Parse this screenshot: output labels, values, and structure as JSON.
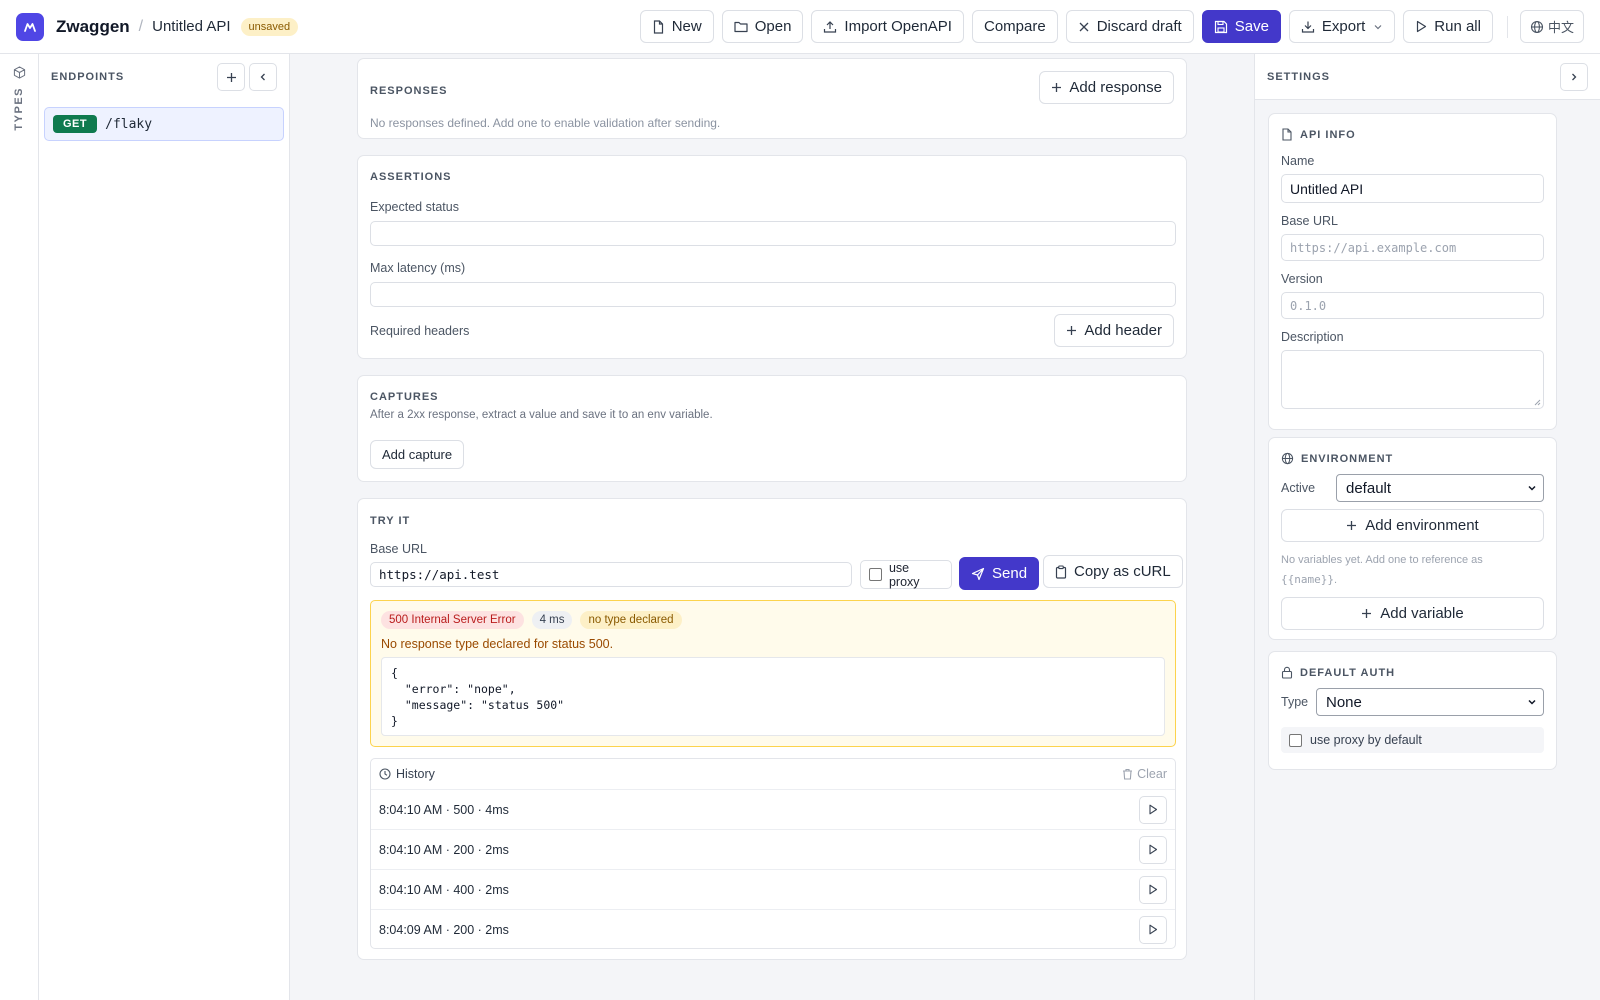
{
  "app": {
    "name": "Zwaggen",
    "separator": "/",
    "project": "Untitled API",
    "status_badge": "unsaved"
  },
  "toolbar": {
    "new": "New",
    "open": "Open",
    "import": "Import OpenAPI",
    "compare": "Compare",
    "discard": "Discard draft",
    "save": "Save",
    "export": "Export",
    "run_all": "Run all",
    "lang": "中文"
  },
  "rail": {
    "types_label": "TYPES"
  },
  "endpoints": {
    "title": "ENDPOINTS",
    "items": [
      {
        "method": "GET",
        "path": "/flaky"
      }
    ]
  },
  "responses": {
    "title": "RESPONSES",
    "add_button": "Add response",
    "empty": "No responses defined. Add one to enable validation after sending."
  },
  "assertions": {
    "title": "ASSERTIONS",
    "expected_status_label": "Expected status",
    "expected_status_value": "",
    "max_latency_label": "Max latency (ms)",
    "max_latency_value": "",
    "required_headers_label": "Required headers",
    "add_header_button": "Add header"
  },
  "captures": {
    "title": "CAPTURES",
    "description": "After a 2xx response, extract a value and save it to an env variable.",
    "add_button": "Add capture"
  },
  "try_it": {
    "title": "TRY IT",
    "base_url_label": "Base URL",
    "base_url_value": "https://api.test",
    "use_proxy_label": "use proxy",
    "use_proxy_checked": false,
    "send_button": "Send",
    "copy_curl_button": "Copy as cURL",
    "result": {
      "status": "500 Internal Server Error",
      "latency": "4 ms",
      "type_badge": "no type declared",
      "warning": "No response type declared for status 500.",
      "body_lines": [
        "{",
        "  \"error\": \"nope\",",
        "  \"message\": \"status 500\"",
        "}"
      ]
    },
    "history": {
      "title": "History",
      "clear": "Clear",
      "rows": [
        "8:04:10 AM · 500 · 4ms",
        "8:04:10 AM · 200 · 2ms",
        "8:04:10 AM · 400 · 2ms",
        "8:04:09 AM · 200 · 2ms"
      ]
    }
  },
  "settings": {
    "title": "SETTINGS",
    "api_info": {
      "title": "API INFO",
      "name_label": "Name",
      "name_value": "Untitled API",
      "base_url_label": "Base URL",
      "base_url_placeholder": "https://api.example.com",
      "version_label": "Version",
      "version_placeholder": "0.1.0",
      "description_label": "Description",
      "description_value": ""
    },
    "environment": {
      "title": "ENVIRONMENT",
      "active_label": "Active",
      "active_value": "default",
      "add_env_button": "Add environment",
      "empty_prefix": "No variables yet. Add one to reference as",
      "empty_token": "{{name}}",
      "empty_suffix": ".",
      "add_var_button": "Add variable"
    },
    "default_auth": {
      "title": "DEFAULT AUTH",
      "type_label": "Type",
      "type_value": "None",
      "proxy_default_label": "use proxy by default"
    }
  },
  "colors": {
    "accent": "#4338ca",
    "get_method": "#0f7a4f",
    "error": "#b91c1c",
    "warning_bg": "#fffbeb",
    "warning_border": "#fcd34d"
  }
}
